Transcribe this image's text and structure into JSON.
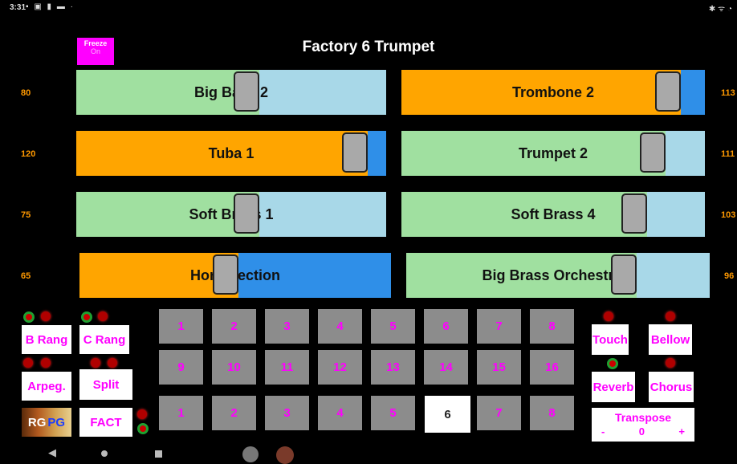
{
  "status": {
    "time": "3:31",
    "icons": "▪ ▣ ▮ ▬ ·",
    "right": "✱ ᯤ ◔"
  },
  "title": "Factory 6 Trumpet",
  "freeze": {
    "label": "Freeze",
    "state": "On"
  },
  "volumes": {
    "left": [
      "80",
      "120",
      "75",
      "65"
    ],
    "right": [
      "113",
      "111",
      "103",
      "96"
    ]
  },
  "sliders": [
    {
      "label": "Big Bass 2",
      "value": 0.59,
      "fill_color": "#a0e0a0",
      "rest_color": "#a8d8e8"
    },
    {
      "label": "Trombone 2",
      "value": 0.92,
      "fill_color": "#ffa500",
      "rest_color": "#2f8fe8"
    },
    {
      "label": "Tuba 1",
      "value": 0.94,
      "fill_color": "#ffa500",
      "rest_color": "#2f8fe8"
    },
    {
      "label": "Trumpet 2",
      "value": 0.87,
      "fill_color": "#a0e0a0",
      "rest_color": "#a8d8e8"
    },
    {
      "label": "Soft Brass 1",
      "value": 0.59,
      "fill_color": "#a0e0a0",
      "rest_color": "#a8d8e8"
    },
    {
      "label": "Soft Brass 4",
      "value": 0.81,
      "fill_color": "#a0e0a0",
      "rest_color": "#a8d8e8"
    },
    {
      "label": "Horn Section",
      "value": 0.51,
      "fill_color": "#ffa500",
      "rest_color": "#2f8fe8"
    },
    {
      "label": "Big Brass Orchestra 1",
      "value": 0.76,
      "fill_color": "#a0e0a0",
      "rest_color": "#a8d8e8"
    }
  ],
  "left_buttons": {
    "b_rang": "B Rang",
    "c_rang": "C Rang",
    "arpeg": "Arpeg.",
    "split": "Split",
    "fact": "FACT",
    "rg": "RG",
    "pg": "PG"
  },
  "right_buttons": {
    "touch": "Touch",
    "bellow": "Bellow",
    "reverb": "Reverb",
    "chorus": "Chorus"
  },
  "transpose": {
    "label": "Transpose",
    "minus": "-",
    "value": "0",
    "plus": "+"
  },
  "pads_row1": [
    "1",
    "2",
    "3",
    "4",
    "5",
    "6",
    "7",
    "8"
  ],
  "pads_row2": [
    "9",
    "10",
    "11",
    "12",
    "13",
    "14",
    "15",
    "16"
  ],
  "pads_row3": [
    "1",
    "2",
    "3",
    "4",
    "5",
    "6",
    "7",
    "8"
  ],
  "selected_pad_row3": "6",
  "nav": {
    "back": "◀"
  }
}
